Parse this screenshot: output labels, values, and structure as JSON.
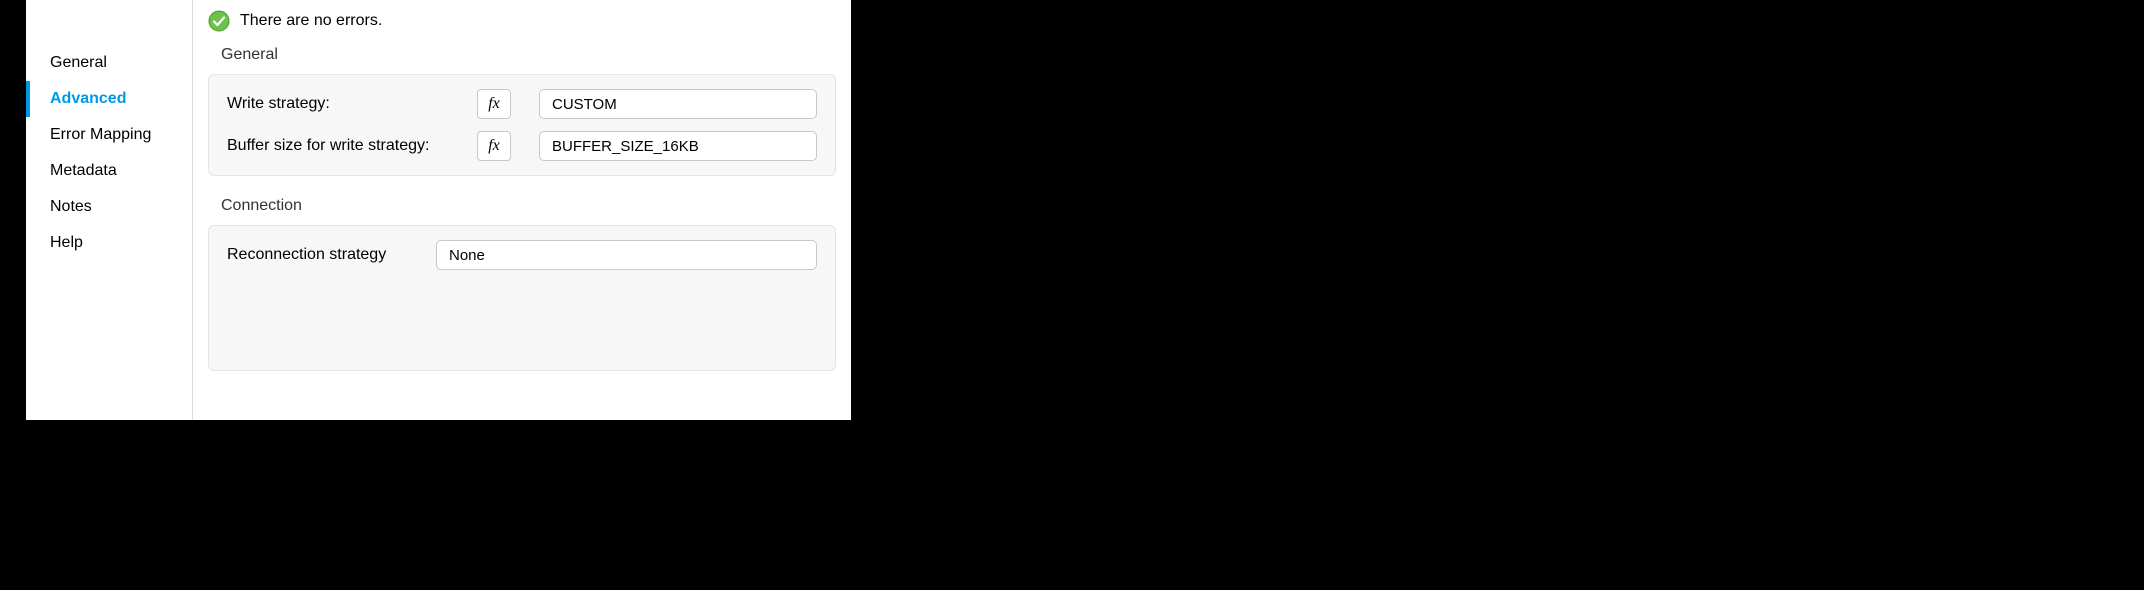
{
  "sidebar": {
    "items": [
      {
        "label": "General"
      },
      {
        "label": "Advanced"
      },
      {
        "label": "Error Mapping"
      },
      {
        "label": "Metadata"
      },
      {
        "label": "Notes"
      },
      {
        "label": "Help"
      }
    ],
    "active_index": 1
  },
  "status": {
    "text": "There are no errors."
  },
  "sections": {
    "general": {
      "title": "General",
      "write_strategy_label": "Write strategy:",
      "write_strategy_value": "CUSTOM",
      "buffer_size_label": "Buffer size for write strategy:",
      "buffer_size_value": "BUFFER_SIZE_16KB"
    },
    "connection": {
      "title": "Connection",
      "reconnection_label": "Reconnection strategy",
      "reconnection_value": "None"
    }
  },
  "fx_label": "fx"
}
